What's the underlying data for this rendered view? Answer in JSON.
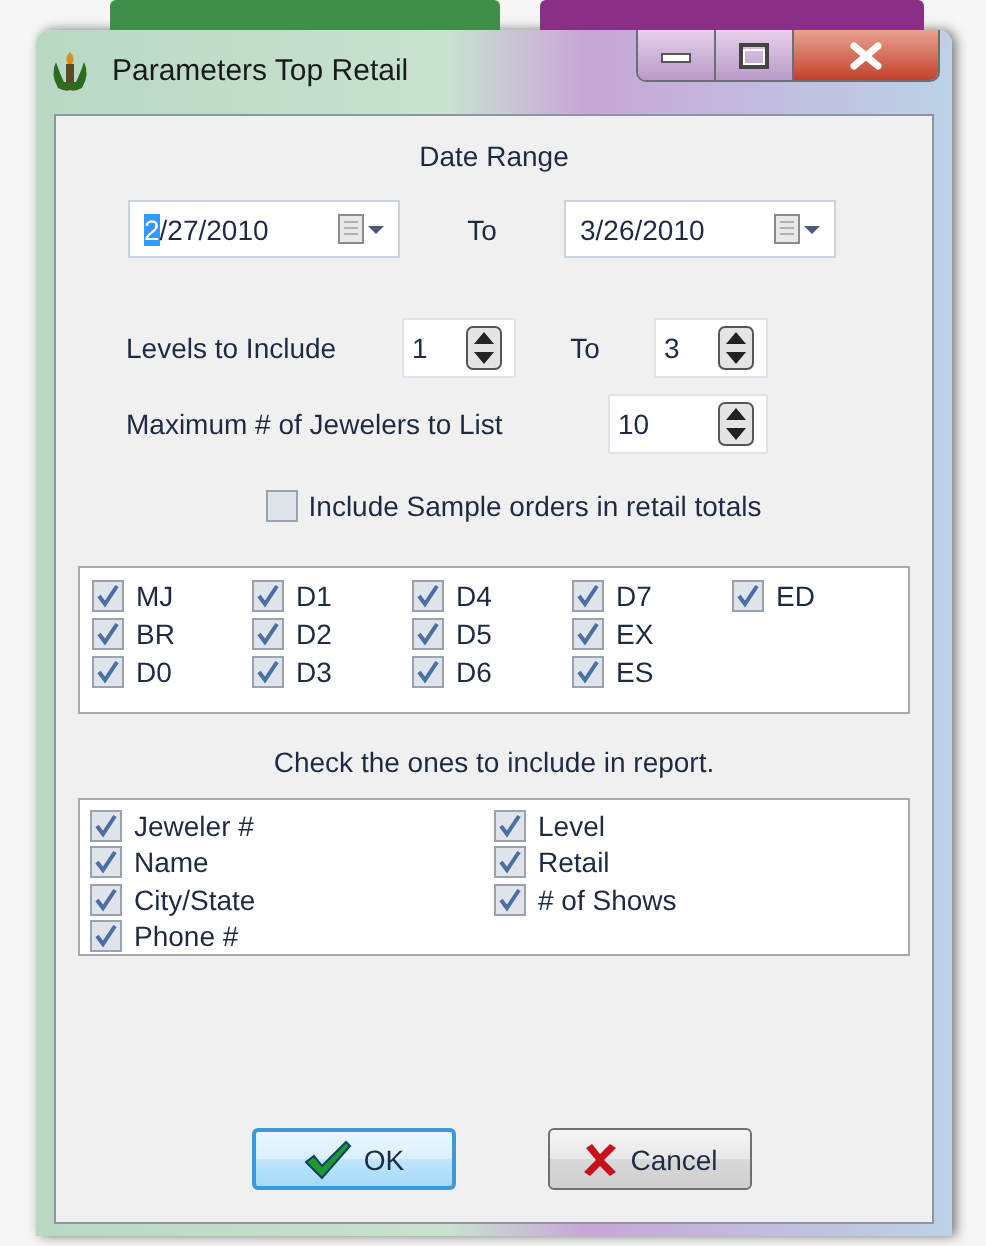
{
  "window": {
    "title": "Parameters Top Retail"
  },
  "date_range": {
    "label": "Date Range",
    "from": {
      "value_selected": "2",
      "value_rest": "/27/2010"
    },
    "to_label": "To",
    "to": {
      "value": "3/26/2010"
    }
  },
  "levels": {
    "label": "Levels to Include",
    "from": "1",
    "to_label": "To",
    "to": "3"
  },
  "max_jewelers": {
    "label": "Maximum # of Jewelers to List",
    "value": "10"
  },
  "include_samples": {
    "label": "Include Sample orders in retail totals",
    "checked": false
  },
  "level_checks": [
    {
      "label": "MJ",
      "checked": true
    },
    {
      "label": "BR",
      "checked": true
    },
    {
      "label": "D0",
      "checked": true
    },
    {
      "label": "D1",
      "checked": true
    },
    {
      "label": "D2",
      "checked": true
    },
    {
      "label": "D3",
      "checked": true
    },
    {
      "label": "D4",
      "checked": true
    },
    {
      "label": "D5",
      "checked": true
    },
    {
      "label": "D6",
      "checked": true
    },
    {
      "label": "D7",
      "checked": true
    },
    {
      "label": "EX",
      "checked": true
    },
    {
      "label": "ES",
      "checked": true
    },
    {
      "label": "ED",
      "checked": true
    }
  ],
  "report_hint": "Check the ones to include in report.",
  "report_fields": [
    {
      "label": "Jeweler #",
      "checked": true
    },
    {
      "label": "Name",
      "checked": true
    },
    {
      "label": "City/State",
      "checked": true
    },
    {
      "label": "Phone #",
      "checked": true
    },
    {
      "label": "Level",
      "checked": true
    },
    {
      "label": "Retail",
      "checked": true
    },
    {
      "label": "# of Shows",
      "checked": true
    }
  ],
  "buttons": [
    {
      "label": "OK",
      "kind": "ok",
      "default": true
    },
    {
      "label": "Cancel",
      "kind": "cancel",
      "default": false
    }
  ]
}
